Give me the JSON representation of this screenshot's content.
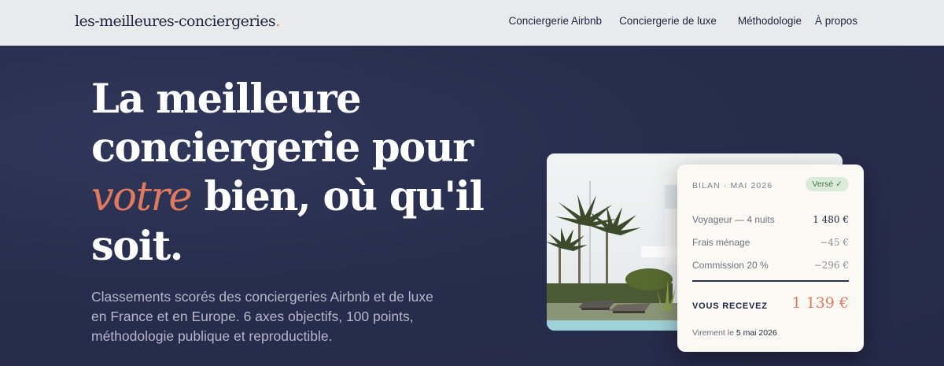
{
  "header": {
    "logo": "les-meilleures-conciergeries",
    "logo_dot": ".",
    "nav": [
      "Conciergerie Airbnb",
      "Conciergerie de luxe",
      "Méthodologie",
      "À propos"
    ]
  },
  "hero": {
    "title_line1": "La meilleure",
    "title_line2": "conciergerie pour",
    "title_em": "votre",
    "title_line3_rest": " bien, où qu'il",
    "title_line4": "soit.",
    "subtitle": "Classements scorés des conciergeries Airbnb et de luxe en France et en Europe. 6 axes objectifs, 100 points, méthodologie publique et reproductible."
  },
  "statement": {
    "heading": "BILAN · MAI 2026",
    "badge": "Versé ✓",
    "rows": [
      {
        "label": "Voyageur — 4 nuits",
        "value": "1 480 €"
      },
      {
        "label": "Frais ménage",
        "value": "−45 €"
      },
      {
        "label": "Commission 20 %",
        "value": "−296 €"
      }
    ],
    "total_label": "VOUS RECEVEZ",
    "total_value": "1 139 €",
    "virement_prefix": "Virement le ",
    "virement_date": "5 mai 2026"
  },
  "colors": {
    "accent": "#e07a5f",
    "navy": "#272d4d",
    "badge_bg": "#dcebd9"
  }
}
